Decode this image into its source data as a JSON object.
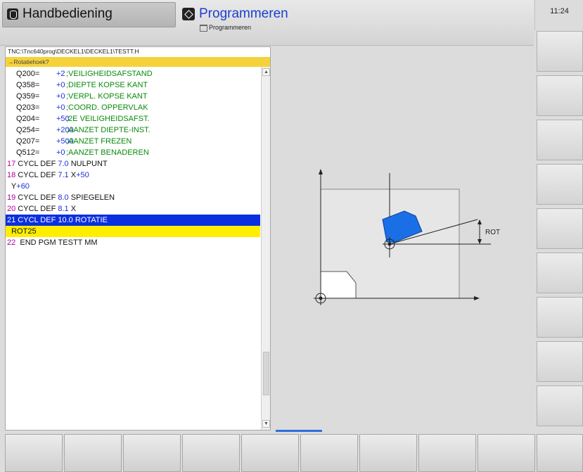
{
  "header": {
    "mode_left": "Handbediening",
    "mode_right": "Programmeren",
    "mode_right_sub": "Programmeren",
    "time": "11:24"
  },
  "program": {
    "path": "TNC:\\Tnc640prog\\DECKEL1\\DECKEL1\\TESTT.H",
    "prompt": "→Rotatiehoek?",
    "params": [
      {
        "name": "Q200=",
        "value": "+2",
        "comment": ";VEILIGHEIDSAFSTAND"
      },
      {
        "name": "Q358=",
        "value": "+0",
        "comment": ";DIEPTE KOPSE KANT"
      },
      {
        "name": "Q359=",
        "value": "+0",
        "comment": ";VERPL. KOPSE KANT"
      },
      {
        "name": "Q203=",
        "value": "+0",
        "comment": ";COORD. OPPERVLAK"
      },
      {
        "name": "Q204=",
        "value": "+50",
        "comment": ";2E VEILIGHEIDSAFST."
      },
      {
        "name": "Q254=",
        "value": "+200",
        "comment": ";AANZET DIEPTE-INST."
      },
      {
        "name": "Q207=",
        "value": "+500",
        "comment": ";AANZET FREZEN"
      },
      {
        "name": "Q512=",
        "value": "+0",
        "comment": ";AANZET BENADEREN"
      }
    ],
    "l17": {
      "num": "17",
      "kw": " CYCL DEF ",
      "cyc": "7.0",
      "rest": " NULPUNT"
    },
    "l18": {
      "num": "18",
      "kw": " CYCL DEF ",
      "cyc": "7.1",
      "rest": " X",
      "val": "+50"
    },
    "l18b": {
      "pre": "  Y",
      "val": "+60"
    },
    "l19": {
      "num": "19",
      "kw": " CYCL DEF ",
      "cyc": "8.0",
      "rest": " SPIEGELEN"
    },
    "l20": {
      "num": "20",
      "kw": " CYCL DEF ",
      "cyc": "8.1",
      "rest": " X"
    },
    "l21": {
      "num": "21",
      "text": " CYCL DEF 10.0 ROTATIE"
    },
    "l21b": "  ROT25",
    "l22": {
      "num": "22",
      "text": "  END PGM TESTT MM"
    }
  },
  "graphic": {
    "rot_label": "ROT",
    "colors": {
      "workpiece": "#e5e5e5",
      "shape": "#1a6fe6",
      "axis": "#222222"
    }
  },
  "softkeys": {
    "right": [
      "",
      "",
      "",
      "",
      "",
      "",
      "",
      "",
      "",
      ""
    ],
    "bottom": [
      "",
      "",
      "",
      "",
      "",
      "",
      "",
      "",
      "",
      ""
    ]
  }
}
